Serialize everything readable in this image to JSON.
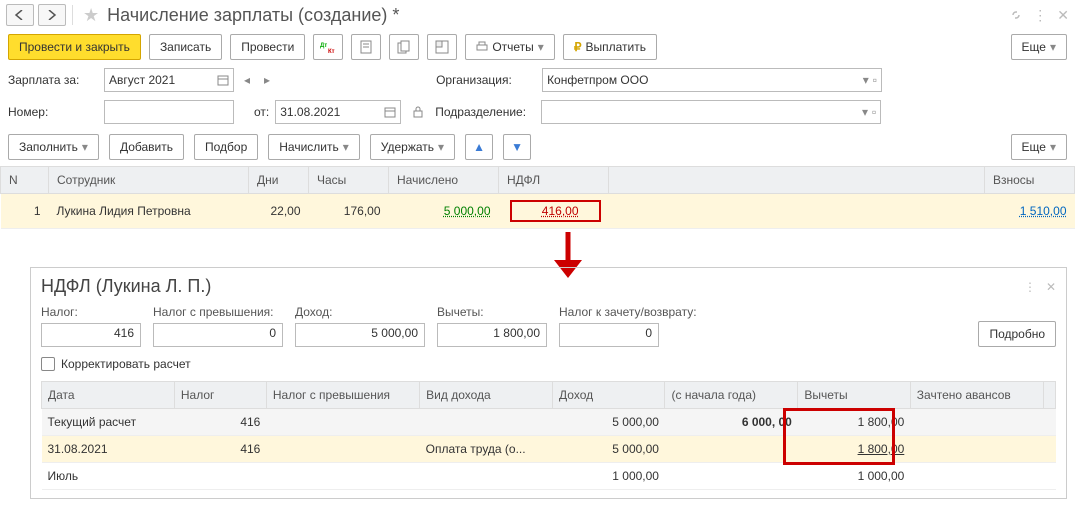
{
  "header": {
    "title": "Начисление зарплаты (создание) *"
  },
  "toolbar": {
    "save_close": "Провести и закрыть",
    "write": "Записать",
    "post": "Провести",
    "reports": "Отчеты",
    "pay": "Выплатить",
    "more": "Еще"
  },
  "form": {
    "salary_for_label": "Зарплата за:",
    "salary_for": "Август 2021",
    "org_label": "Организация:",
    "org": "Конфетпром ООО",
    "number_label": "Номер:",
    "number": "",
    "from_label": "от:",
    "from": "31.08.2021",
    "dept_label": "Подразделение:",
    "dept": ""
  },
  "tbl_toolbar": {
    "fill": "Заполнить",
    "add": "Добавить",
    "pick": "Подбор",
    "calc": "Начислить",
    "hold": "Удержать",
    "more": "Еще"
  },
  "main_table": {
    "headers": {
      "n": "N",
      "employee": "Сотрудник",
      "days": "Дни",
      "hours": "Часы",
      "accrued": "Начислено",
      "ndfl": "НДФЛ",
      "contrib": "Взносы"
    },
    "rows": [
      {
        "n": "1",
        "employee": "Лукина Лидия Петровна",
        "days": "22,00",
        "hours": "176,00",
        "accrued": "5 000,00",
        "ndfl": "416,00",
        "contrib": "1 510,00"
      }
    ]
  },
  "detail": {
    "title": "НДФЛ (Лукина Л. П.)",
    "labels": {
      "tax": "Налог:",
      "excess": "Налог с превышения:",
      "income": "Доход:",
      "deductions": "Вычеты:",
      "refund": "Налог к зачету/возврату:"
    },
    "values": {
      "tax": "416",
      "excess": "0",
      "income": "5 000,00",
      "deductions": "1 800,00",
      "refund": "0"
    },
    "details_btn": "Подробно",
    "adjust_label": "Корректировать расчет",
    "table": {
      "headers": {
        "date": "Дата",
        "tax": "Налог",
        "excess": "Налог с превышения",
        "income_type": "Вид дохода",
        "income": "Доход",
        "since_start": "(с начала года)",
        "deductions": "Вычеты",
        "advance": "Зачтено авансов"
      },
      "rows": [
        {
          "date": "Текущий расчет",
          "tax": "416",
          "excess": "",
          "income_type": "",
          "income": "5 000,00",
          "since_start": "6 000, 00",
          "deductions": "1 800,00",
          "advance": ""
        },
        {
          "date": "31.08.2021",
          "tax": "416",
          "excess": "",
          "income_type": "Оплата труда (о...",
          "income": "5 000,00",
          "since_start": "",
          "deductions": "1 800,00",
          "advance": ""
        },
        {
          "date": "Июль",
          "tax": "",
          "excess": "",
          "income_type": "",
          "income": "1 000,00",
          "since_start": "",
          "deductions": "1 000,00",
          "advance": ""
        }
      ]
    }
  }
}
